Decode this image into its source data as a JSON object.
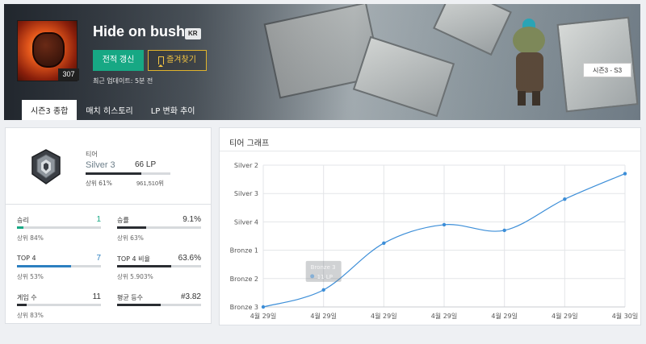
{
  "profile": {
    "name": "Hide on bush",
    "region": "KR",
    "level": "307",
    "renew_label": "전적 갱신",
    "favorite_label": "즐겨찾기",
    "updated": "최근 업데이트: 5분 전",
    "season_badge": "시즌3 - S3"
  },
  "tabs": [
    "시즌3 종합",
    "매치 히스토리",
    "LP 변화 추이"
  ],
  "tier": {
    "label": "티어",
    "name": "Silver 3",
    "lp": "66 LP",
    "lp_fraction": 0.66,
    "percentile": "상위 61%",
    "rank": "961,510위"
  },
  "stats": [
    {
      "label": "승리",
      "value": "1",
      "sub": "상위 84%",
      "fill": 0.08,
      "color": "#17a884"
    },
    {
      "label": "승률",
      "value": "9.1%",
      "sub": "상위 63%",
      "fill": 0.35,
      "color": "#2a2d32"
    },
    {
      "label": "TOP 4",
      "value": "7",
      "sub": "상위 53%",
      "fill": 0.64,
      "color": "#2c7fc0"
    },
    {
      "label": "TOP 4 비율",
      "value": "63.6%",
      "sub": "상위 5.903%",
      "fill": 0.64,
      "color": "#2a2d32"
    },
    {
      "label": "게임 수",
      "value": "11",
      "sub": "상위 83%",
      "fill": 0.12,
      "color": "#2a2d32"
    },
    {
      "label": "평균 등수",
      "value": "#3.82",
      "sub": "",
      "fill": 0.52,
      "color": "#2a2d32"
    }
  ],
  "graph": {
    "title": "티어 그래프",
    "tooltip_title": "Bronze 3",
    "tooltip_value": "11 LP"
  },
  "chart_data": {
    "type": "line",
    "title": "티어 그래프",
    "xlabel": "",
    "ylabel": "",
    "y_tick_labels": [
      "Bronze 3",
      "Bronze 2",
      "Bronze 1",
      "Silver 4",
      "Silver 3",
      "Silver 2"
    ],
    "ylim": [
      0,
      5
    ],
    "x": [
      "4월 29일",
      "4월 29일",
      "4월 29일",
      "4월 29일",
      "4월 29일",
      "4월 29일",
      "4월 30일"
    ],
    "series": [
      {
        "values": [
          0.0,
          0.6,
          2.25,
          2.9,
          2.7,
          3.8,
          4.7
        ]
      }
    ],
    "grid": true,
    "color": "#3c8ed8"
  }
}
